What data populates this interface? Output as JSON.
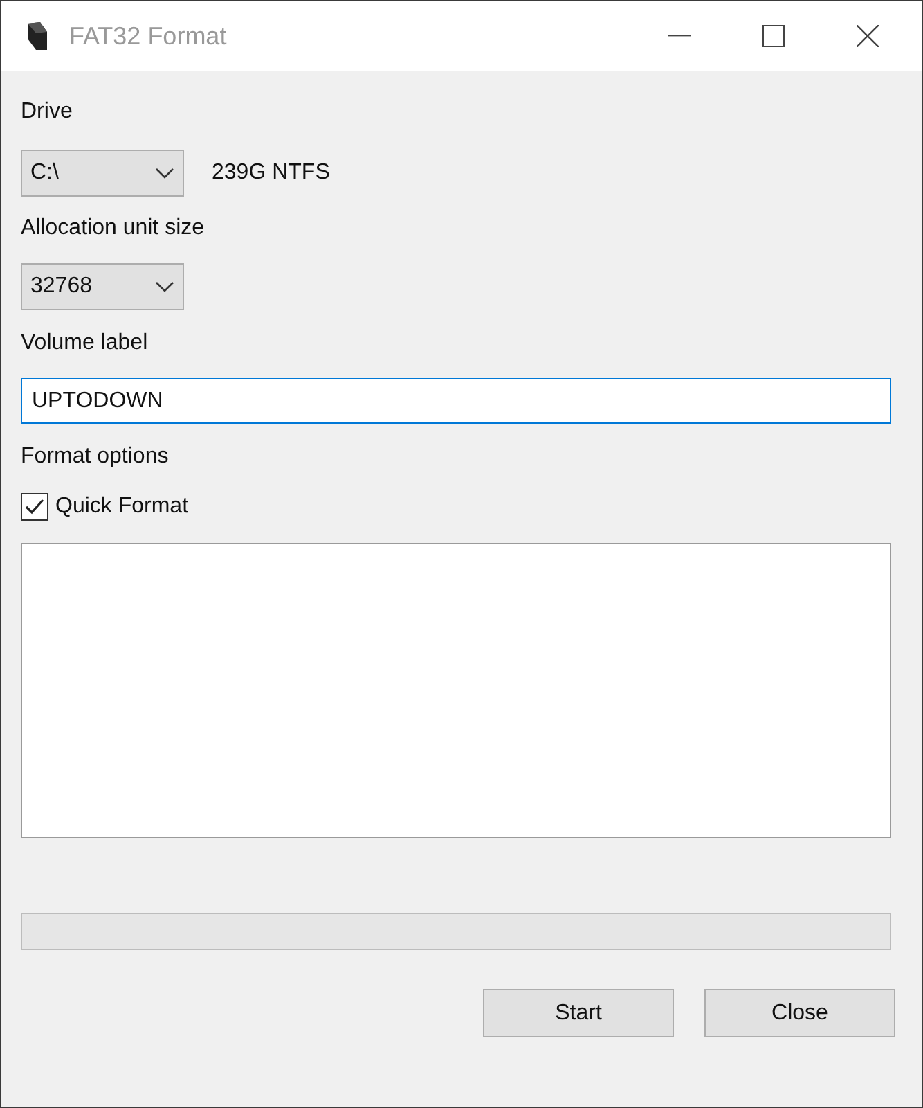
{
  "window": {
    "title": "FAT32 Format"
  },
  "drive": {
    "label": "Drive",
    "value": "C:\\",
    "info": "239G NTFS"
  },
  "allocation": {
    "label": "Allocation unit size",
    "value": "32768"
  },
  "volume": {
    "label": "Volume label",
    "value": "UPTODOWN"
  },
  "options": {
    "label": "Format options",
    "items": [
      {
        "label": "Quick Format",
        "checked": true
      }
    ]
  },
  "progress": {
    "level": 0
  },
  "buttons": [
    "Start",
    "Close"
  ]
}
